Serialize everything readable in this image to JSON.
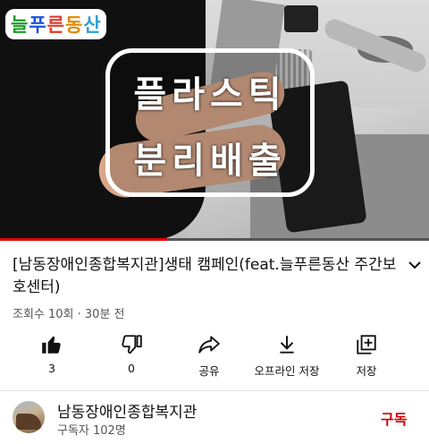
{
  "video": {
    "logo_chars": [
      "늘",
      "푸",
      "른",
      "동",
      "산"
    ],
    "logo_colors": [
      "#1f9a2e",
      "#1c55d6",
      "#e03a2b",
      "#e08a00",
      "#2aa0d8"
    ],
    "overlay_line1": "플라스틱",
    "overlay_line2": "분리배출",
    "progress_fraction": 0.39,
    "progress_color": "#e00000"
  },
  "title": "[남동장애인종합복지관]생태 캠페인(feat.늘푸른동산 주간보호센터)",
  "meta": "조회수 10회 · 30분 전",
  "actions": [
    {
      "icon": "thumbs-up-icon",
      "label": "3"
    },
    {
      "icon": "thumbs-down-icon",
      "label": "0"
    },
    {
      "icon": "share-icon",
      "label": "공유"
    },
    {
      "icon": "download-icon",
      "label": "오프라인 저장"
    },
    {
      "icon": "save-to-playlist-icon",
      "label": "저장"
    }
  ],
  "channel": {
    "name": "남동장애인종합복지관",
    "subscribers": "구독자 102명",
    "subscribe_label": "구독",
    "subscribe_color": "#cc0000"
  }
}
